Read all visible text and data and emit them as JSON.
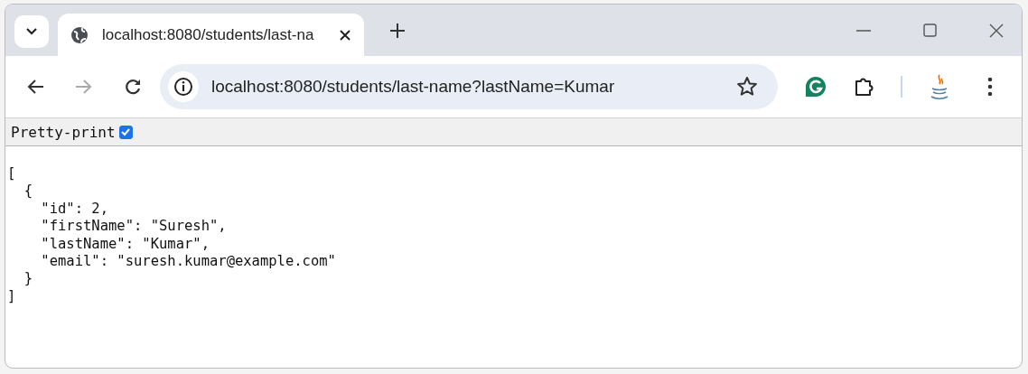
{
  "tab_strip": {
    "tabs": [
      {
        "title": "localhost:8080/students/last-na",
        "selected": true
      }
    ]
  },
  "toolbar": {
    "address": "localhost:8080/students/last-name?lastName=Kumar",
    "forward_disabled": true
  },
  "pretty_print": {
    "label": "Pretty-print",
    "checked": true
  },
  "json_text": "[\n  {\n    \"id\": 2,\n    \"firstName\": \"Suresh\",\n    \"lastName\": \"Kumar\",\n    \"email\": \"suresh.kumar@example.com\"\n  }\n]"
}
